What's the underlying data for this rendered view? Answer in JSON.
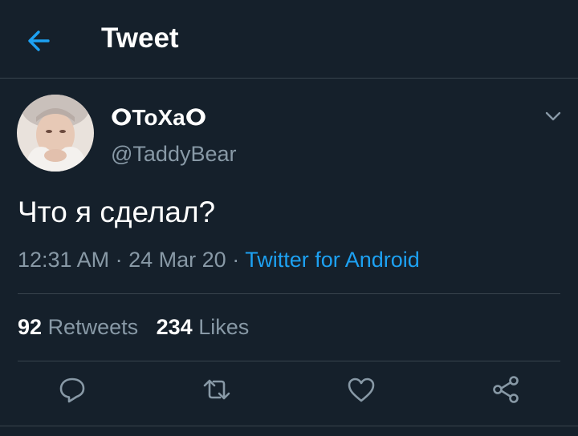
{
  "header": {
    "title": "Tweet",
    "back_icon": "arrow-left-icon"
  },
  "tweet": {
    "display_name": "ⵔToXaⵔ",
    "handle": "@TaddyBear",
    "text": "Что я сделал?",
    "time": "12:31 AM",
    "date": "24 Mar 20",
    "separator": "·",
    "source": "Twitter for Android",
    "retweets_count": "92",
    "retweets_label": "Retweets",
    "likes_count": "234",
    "likes_label": "Likes"
  },
  "actions": [
    "reply-icon",
    "retweet-icon",
    "like-icon",
    "share-icon"
  ],
  "colors": {
    "background": "#15202b",
    "accent": "#1da1f2",
    "secondary_text": "#8899a6",
    "divider": "#38444d"
  }
}
